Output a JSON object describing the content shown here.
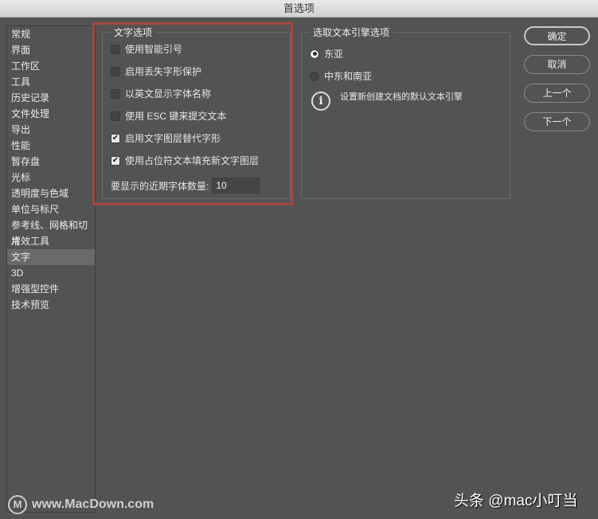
{
  "window": {
    "title": "首选项"
  },
  "sidebar": {
    "items": [
      "常规",
      "界面",
      "工作区",
      "工具",
      "历史记录",
      "文件处理",
      "导出",
      "性能",
      "暂存盘",
      "光标",
      "透明度与色域",
      "单位与标尺",
      "参考线、网格和切片",
      "增效工具",
      "文字",
      "3D",
      "增强型控件",
      "技术预览"
    ],
    "selected": "文字"
  },
  "text_options": {
    "title": "文字选项",
    "checkboxes": [
      {
        "label": "使用智能引号",
        "checked": false
      },
      {
        "label": "启用丢失字形保护",
        "checked": false
      },
      {
        "label": "以英文显示字体名称",
        "checked": false
      },
      {
        "label": "使用 ESC 键来提交文本",
        "checked": false
      },
      {
        "label": "启用文字图层替代字形",
        "checked": true
      },
      {
        "label": "使用占位符文本填充新文字图层",
        "checked": true
      }
    ],
    "recent_fonts_label": "要显示的近期字体数量:",
    "recent_fonts_value": "10"
  },
  "engine": {
    "title": "选取文本引擎选项",
    "options": [
      {
        "label": "东亚",
        "selected": true
      },
      {
        "label": "中东和南亚",
        "selected": false
      }
    ],
    "info": "设置新创建文档的默认文本引擎"
  },
  "buttons": {
    "ok": "确定",
    "cancel": "取消",
    "prev": "上一个",
    "next": "下一个"
  },
  "watermark": {
    "left": "www.MacDown.com",
    "right": "头条 @mac小叮当",
    "logo": "M"
  },
  "colors": {
    "highlight": "#a5473f",
    "background": "#535353"
  }
}
